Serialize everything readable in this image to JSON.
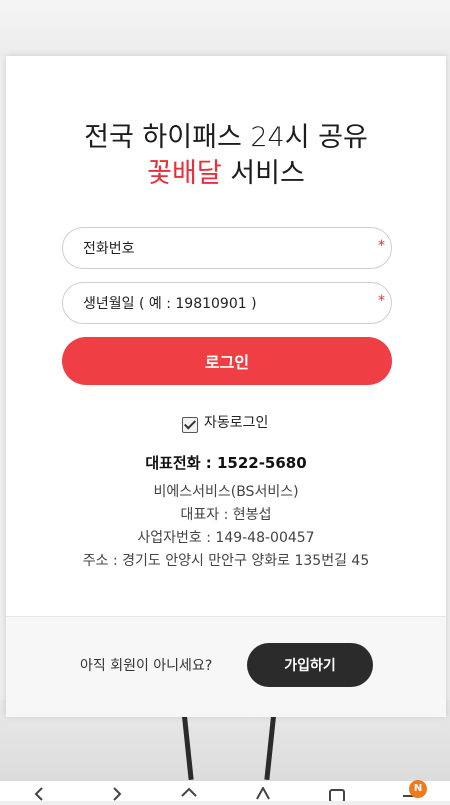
{
  "header": {
    "title_line1": "전국 하이패스 24시 공유",
    "title_accent": "꽃배달",
    "title_rest": " 서비스"
  },
  "form": {
    "phone_placeholder": "전화번호",
    "birth_placeholder": "생년월일 ( 예 : 19810901 )",
    "required_mark": "*",
    "login_label": "로그인",
    "auto_login_label": "자동로그인",
    "auto_login_checked": true
  },
  "company": {
    "phone_label": "대표전화 : 1522-5680",
    "name": "비에스서비스(BS서비스)",
    "ceo": "대표자 : 현봉섭",
    "business_no": "사업자번호 : 149-48-00457",
    "address": "주소 : 경기도 안양시 만안구 양화로 135번길 45"
  },
  "footer": {
    "question": "아직 회원이 아니세요?",
    "join_label": "가입하기"
  },
  "navbar": {
    "icons": [
      "back-icon",
      "forward-icon",
      "home-icon",
      "star-icon",
      "tabs-icon",
      "menu-icon"
    ],
    "badge": "N"
  },
  "colors": {
    "accent": "#ef3f44",
    "dark_button": "#2b2b2b",
    "badge": "#f07b1e"
  }
}
